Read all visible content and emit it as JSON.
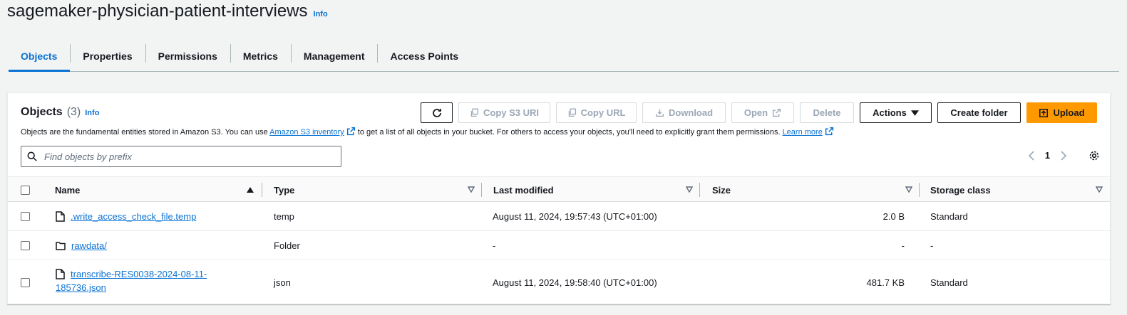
{
  "header": {
    "title": "sagemaker-physician-patient-interviews",
    "info": "Info"
  },
  "tabs": [
    {
      "label": "Objects",
      "active": true
    },
    {
      "label": "Properties"
    },
    {
      "label": "Permissions"
    },
    {
      "label": "Metrics"
    },
    {
      "label": "Management"
    },
    {
      "label": "Access Points"
    }
  ],
  "objects_panel": {
    "title": "Objects",
    "count": "(3)",
    "info": "Info",
    "description_1": "Objects are the fundamental entities stored in Amazon S3. You can use ",
    "inventory_link": "Amazon S3 inventory",
    "description_2": " to get a list of all objects in your bucket. For others to access your objects, you'll need to explicitly grant them permissions. ",
    "learn_more": "Learn more"
  },
  "toolbar": {
    "copy_s3_uri": "Copy S3 URI",
    "copy_url": "Copy URL",
    "download": "Download",
    "open": "Open",
    "delete": "Delete",
    "actions": "Actions",
    "create_folder": "Create folder",
    "upload": "Upload"
  },
  "search": {
    "placeholder": "Find objects by prefix"
  },
  "pagination": {
    "page": "1"
  },
  "table": {
    "columns": [
      "Name",
      "Type",
      "Last modified",
      "Size",
      "Storage class"
    ],
    "rows": [
      {
        "name": ".write_access_check_file.temp",
        "icon": "file-icon",
        "type": "temp",
        "last_modified": "August 11, 2024, 19:57:43 (UTC+01:00)",
        "size": "2.0 B",
        "storage_class": "Standard"
      },
      {
        "name": "rawdata/",
        "icon": "folder-icon",
        "type": "Folder",
        "last_modified": "-",
        "size": "-",
        "storage_class": "-"
      },
      {
        "name_line1": "transcribe-RES0038-2024-08-11-",
        "name_line2": "185736.json",
        "icon": "file-icon",
        "type": "json",
        "last_modified": "August 11, 2024, 19:58:40 (UTC+01:00)",
        "size": "481.7 KB",
        "storage_class": "Standard"
      }
    ]
  },
  "colors": {
    "accent": "#0972d3",
    "primary_button": "#ff9900",
    "disabled_text": "#9ba7b6"
  }
}
